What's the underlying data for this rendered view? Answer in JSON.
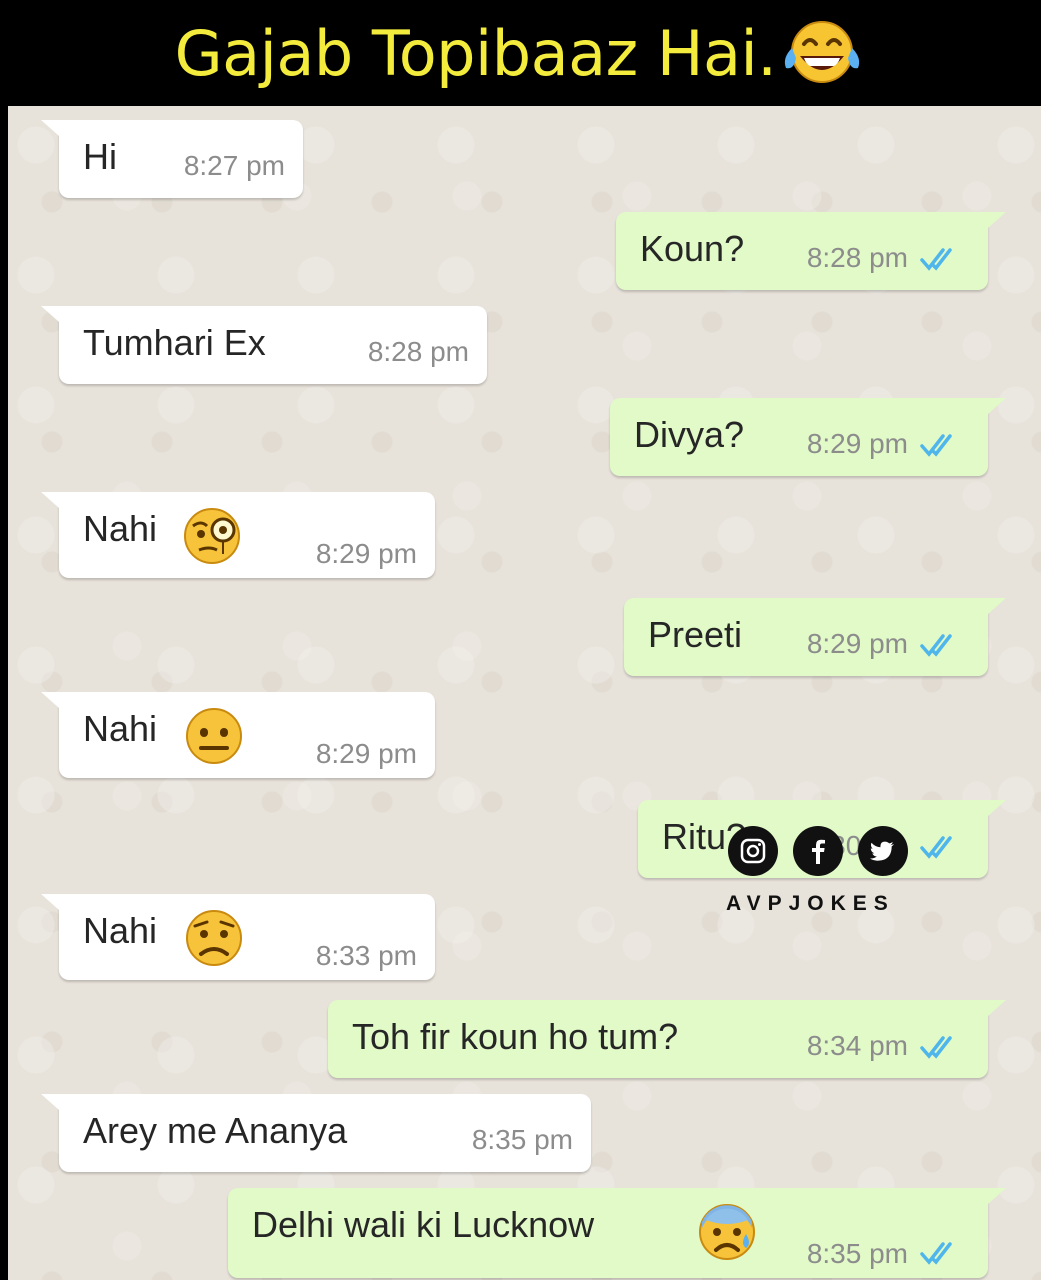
{
  "banner": {
    "title": "Gajab Topibaaz Hai.",
    "emoji": "laughing-tears-emoji"
  },
  "messages": [
    {
      "dir": "in",
      "text": "Hi",
      "time": "8:27 pm"
    },
    {
      "dir": "out",
      "text": "Koun?",
      "time": "8:28 pm",
      "status": "read"
    },
    {
      "dir": "in",
      "text": "Tumhari Ex",
      "time": "8:28 pm"
    },
    {
      "dir": "out",
      "text": "Divya?",
      "time": "8:29 pm",
      "status": "read"
    },
    {
      "dir": "in",
      "text": "Nahi",
      "emoji": "monocle-face-emoji",
      "time": "8:29 pm"
    },
    {
      "dir": "out",
      "text": "Preeti",
      "time": "8:29 pm",
      "status": "read"
    },
    {
      "dir": "in",
      "text": "Nahi",
      "emoji": "neutral-face-emoji",
      "time": "8:29 pm"
    },
    {
      "dir": "out",
      "text": "Ritu?",
      "time": "8:30 pm",
      "status": "read"
    },
    {
      "dir": "in",
      "text": "Nahi",
      "emoji": "worried-face-emoji",
      "time": "8:33 pm"
    },
    {
      "dir": "out",
      "text": "Toh fir koun ho tum?",
      "time": "8:34 pm",
      "status": "read"
    },
    {
      "dir": "in",
      "text": "Arey me Ananya",
      "time": "8:35 pm"
    },
    {
      "dir": "out",
      "text": "Delhi wali ki Lucknow",
      "emoji": "anxious-sweat-face-emoji",
      "time": "8:35 pm",
      "status": "read"
    }
  ],
  "watermark": {
    "text": "AVPJOKES",
    "icons": [
      "instagram-icon",
      "facebook-icon",
      "twitter-icon"
    ]
  },
  "colors": {
    "incoming": "#ffffff",
    "outgoing": "#e1fac8",
    "ticks": "#4fb6ec",
    "banner_text": "#f4ec3c"
  }
}
